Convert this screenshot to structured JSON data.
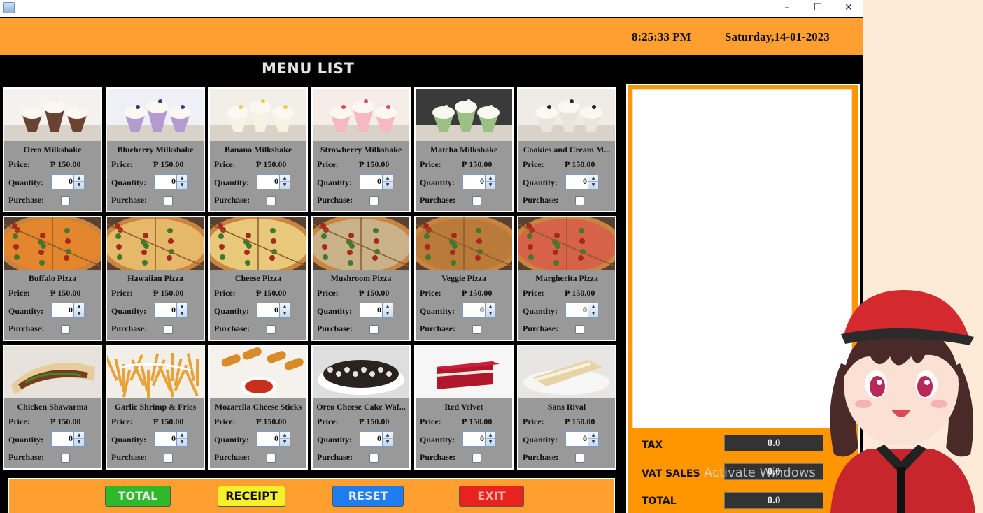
{
  "window": {
    "minimize_glyph": "–",
    "maximize_glyph": "☐",
    "close_glyph": "✕"
  },
  "header": {
    "time": "8:25:33 PM",
    "date": "Saturday,14-01-2023"
  },
  "menu_title": "MENU LIST",
  "labels": {
    "price": "Price:",
    "quantity": "Quantity:",
    "purchase": "Purchase:"
  },
  "items": [
    {
      "name": "Oreo Milkshake",
      "price": "₱ 150.00",
      "qty": "0",
      "photo": "milkshake-chocolate"
    },
    {
      "name": "Blueberry Milkshake",
      "price": "₱ 150.00",
      "qty": "0",
      "photo": "milkshake-blueberry"
    },
    {
      "name": "Banana Milkshake",
      "price": "₱ 150.00",
      "qty": "0",
      "photo": "milkshake-banana"
    },
    {
      "name": "Strawberry Milkshake",
      "price": "₱ 150.00",
      "qty": "0",
      "photo": "milkshake-strawberry"
    },
    {
      "name": "Matcha Milkshake",
      "price": "₱ 150.00",
      "qty": "0",
      "photo": "milkshake-matcha"
    },
    {
      "name": "Cookies and Cream M...",
      "price": "₱ 150.00",
      "qty": "0",
      "photo": "milkshake-cookies"
    },
    {
      "name": "Buffalo Pizza",
      "price": "₱ 150.00",
      "qty": "0",
      "photo": "pizza-buffalo"
    },
    {
      "name": "Hawaiian Pizza",
      "price": "₱ 150.00",
      "qty": "0",
      "photo": "pizza-hawaiian"
    },
    {
      "name": "Cheese Pizza",
      "price": "₱ 150.00",
      "qty": "0",
      "photo": "pizza-cheese"
    },
    {
      "name": "Mushroom Pizza",
      "price": "₱ 150.00",
      "qty": "0",
      "photo": "pizza-mushroom"
    },
    {
      "name": "Veggie Pizza",
      "price": "₱ 150.00",
      "qty": "0",
      "photo": "pizza-veggie"
    },
    {
      "name": "Margherita Pizza",
      "price": "₱ 150.00",
      "qty": "0",
      "photo": "pizza-margherita"
    },
    {
      "name": "Chicken Shawarma",
      "price": "₱ 150.00",
      "qty": "0",
      "photo": "shawarma"
    },
    {
      "name": "Garlic Shrimp & Fries",
      "price": "₱ 150.00",
      "qty": "0",
      "photo": "shrimp-fries"
    },
    {
      "name": "Mozarella Cheese Sticks",
      "price": "₱ 150.00",
      "qty": "0",
      "photo": "cheese-sticks"
    },
    {
      "name": "Oreo Cheese Cake Waf...",
      "price": "₱ 150.00",
      "qty": "0",
      "photo": "oreo-waffle"
    },
    {
      "name": "Red Velvet",
      "price": "₱ 150.00",
      "qty": "0",
      "photo": "red-velvet-cake"
    },
    {
      "name": "Sans Rival",
      "price": "₱ 150.00",
      "qty": "0",
      "photo": "sans-rival-cake"
    }
  ],
  "buttons": {
    "total": "TOTAL",
    "receipt": "RECEIPT",
    "reset": "RESET",
    "exit": "EXIT"
  },
  "summary": {
    "tax_label": "TAX",
    "tax_value": "0.0",
    "vat_label": "VAT SALES",
    "vat_value": "0.0",
    "total_label": "TOTAL",
    "total_value": "0.0"
  },
  "watermark": "Activate Windows",
  "colors": {
    "header_orange": "#ff9f30",
    "panel_orange": "#ff9600",
    "card_gray": "#999999",
    "total_green": "#2fb82a",
    "receipt_yellow": "#f5f02a",
    "reset_blue": "#1e7df0",
    "exit_red": "#e8231f"
  }
}
